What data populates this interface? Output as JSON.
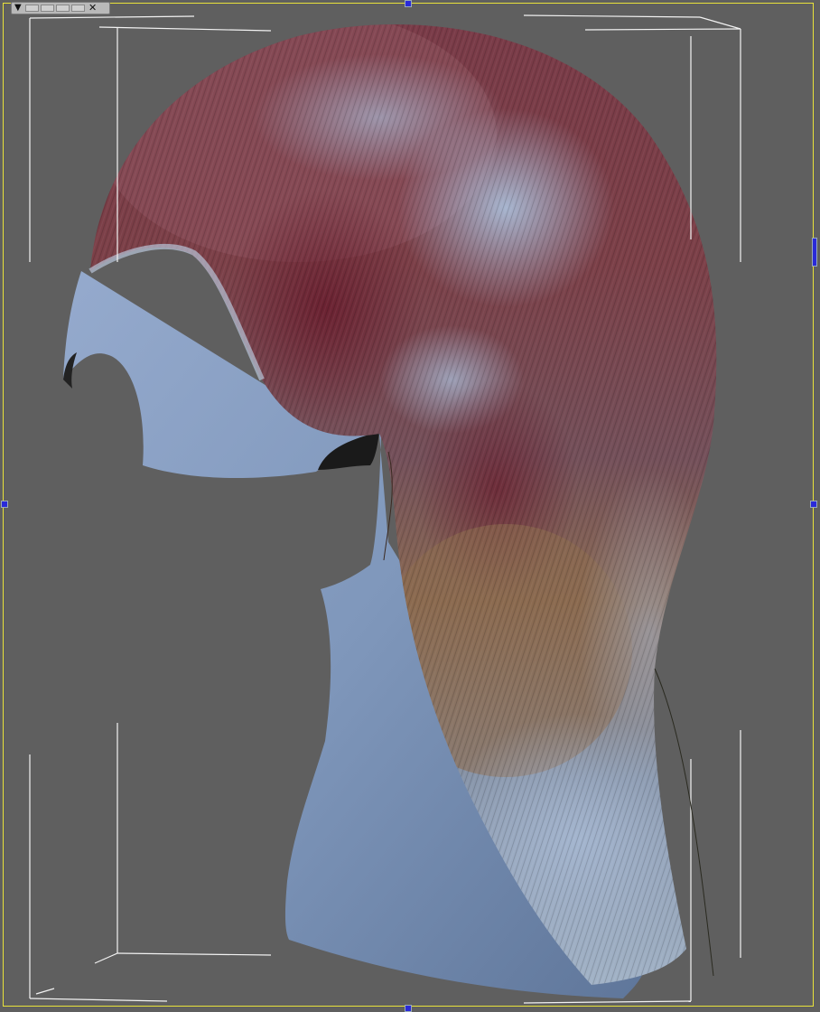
{
  "toolbar": {
    "menu_glyph": "▼",
    "close_glyph": "✕",
    "slot_count": 5
  },
  "colors": {
    "background": "#5f5f5f",
    "frame": "#e8e23a",
    "bounds": "#f2f2f2",
    "skin": "#7f97bb",
    "hair_red": "#7a3b44",
    "hair_blue": "#9aacc4",
    "hair_tan": "#8a7a62"
  },
  "icons": [
    "menu-arrow-icon",
    "close-icon"
  ]
}
